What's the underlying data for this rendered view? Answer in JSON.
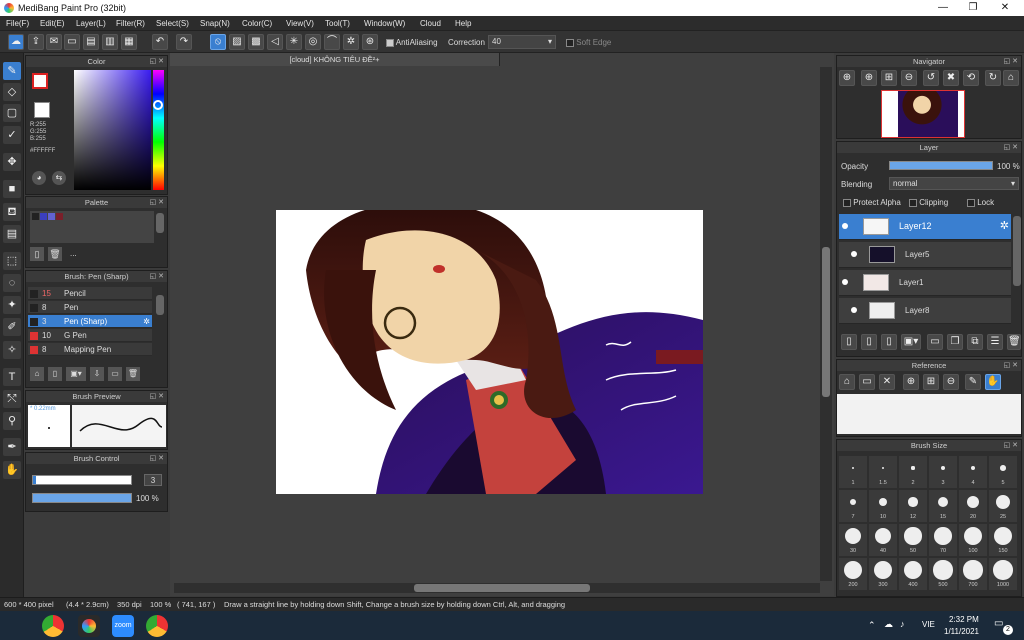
{
  "window": {
    "title": "MediBang Paint Pro (32bit)",
    "minimize": "—",
    "maximize": "❐",
    "close": "✕"
  },
  "menu": [
    "File(F)",
    "Edit(E)",
    "Layer(L)",
    "Filter(R)",
    "Select(S)",
    "Snap(N)",
    "Color(C)",
    "View(V)",
    "Tool(T)",
    "Window(W)",
    "Cloud",
    "Help"
  ],
  "toolbar": {
    "antialiasing": "AntiAliasing",
    "correction_label": "Correction",
    "correction_value": "40",
    "soft_edge": "Soft Edge"
  },
  "color_panel": {
    "title": "Color",
    "r": "R:255",
    "g": "G:255",
    "b": "B:255",
    "hex": "#FFFFFF"
  },
  "palette_panel": {
    "title": "Palette",
    "more": "..."
  },
  "brush_panel": {
    "title": "Brush: Pen (Sharp)",
    "items": [
      {
        "size": "15",
        "name": "Pencil"
      },
      {
        "size": "8",
        "name": "Pen"
      },
      {
        "size": "3",
        "name": "Pen (Sharp)"
      },
      {
        "size": "10",
        "name": "G Pen"
      },
      {
        "size": "8",
        "name": "Mapping Pen"
      }
    ]
  },
  "brush_preview": {
    "title": "Brush Preview",
    "size": "* 0.22mm"
  },
  "brush_control": {
    "title": "Brush Control",
    "size_value": "3",
    "opacity_value": "100 %",
    "size_fraction": 0.03,
    "opacity_fraction": 1.0
  },
  "document": {
    "tab": "[cloud] KHÔNG TIÊU ĐỀ²+"
  },
  "navigator": {
    "title": "Navigator"
  },
  "layer_panel": {
    "title": "Layer",
    "opacity_label": "Opacity",
    "opacity_value": "100 %",
    "blending_label": "Blending",
    "blending_value": "normal",
    "protect_alpha": "Protect Alpha",
    "clipping": "Clipping",
    "lock": "Lock",
    "layers": [
      {
        "name": "Layer12"
      },
      {
        "name": "Layer5"
      },
      {
        "name": "Layer1"
      },
      {
        "name": "Layer8"
      }
    ]
  },
  "reference_panel": {
    "title": "Reference"
  },
  "brush_size_panel": {
    "title": "Brush Size",
    "sizes": [
      "1",
      "1.5",
      "2",
      "3",
      "4",
      "5",
      "7",
      "10",
      "12",
      "15",
      "20",
      "25",
      "30",
      "40",
      "50",
      "70",
      "100",
      "150",
      "200",
      "300",
      "400",
      "500",
      "700",
      "1000"
    ]
  },
  "status": {
    "dimensions": "600 * 400 pixel",
    "physical": "(4.4 * 2.9cm)",
    "dpi": "350 dpi",
    "zoom": "100 %",
    "coords": "( 741, 167 )",
    "hint": "Draw a straight line by holding down Shift, Change a brush size by holding down Ctrl, Alt, and dragging"
  },
  "taskbar": {
    "time": "2:32 PM",
    "date": "1/11/2021",
    "lang": "VIE",
    "notifications": "2"
  },
  "colors": {
    "accent": "#3a7fd0",
    "panel": "#2e2e2e",
    "canvas_bg": "#3f3f3f"
  }
}
